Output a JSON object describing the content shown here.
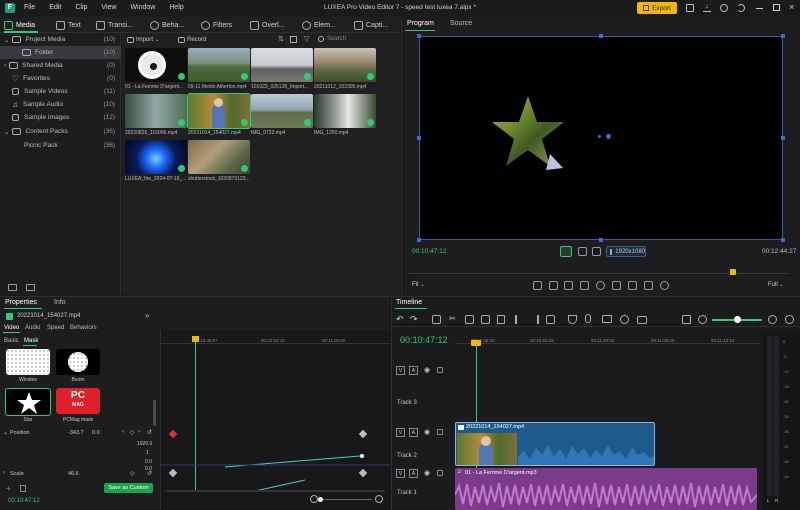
{
  "app": {
    "logo_glyph": "F",
    "menu": [
      "File",
      "Edit",
      "Clip",
      "View",
      "Window",
      "Help"
    ],
    "title": "LUXEA Pro Video Editor 7 - speed test luxea 7.alpx *",
    "export_label": "Export",
    "accent": "#f5b700"
  },
  "tabs": [
    {
      "label": "Media",
      "icon": "media-icon"
    },
    {
      "label": "Text",
      "icon": "text-icon"
    },
    {
      "label": "Transi...",
      "icon": "transition-icon"
    },
    {
      "label": "Beha...",
      "icon": "behavior-icon"
    },
    {
      "label": "Filters",
      "icon": "filters-icon"
    },
    {
      "label": "Overl...",
      "icon": "overlay-icon"
    },
    {
      "label": "Elem...",
      "icon": "elements-icon"
    },
    {
      "label": "Capti...",
      "icon": "captions-icon"
    }
  ],
  "library": {
    "tree": [
      {
        "label": "Project Media",
        "count": "(10)"
      },
      {
        "label": "Folder",
        "count": "(10)"
      },
      {
        "label": "Shared Media",
        "count": "(0)"
      },
      {
        "label": "Favorites",
        "count": "(0)"
      },
      {
        "label": "Sample Videos",
        "count": "(11)"
      },
      {
        "label": "Sample Audio",
        "count": "(10)"
      },
      {
        "label": "Sample Images",
        "count": "(12)"
      },
      {
        "label": "Content Packs",
        "count": "(36)"
      },
      {
        "label": "Picnic Pack",
        "count": "(36)"
      }
    ],
    "import_label": "Import",
    "record_label": "Record",
    "search_placeholder": "Search",
    "items": [
      "01 - La Femme D'argent...",
      "09-11 Menlo Atherton.mp4",
      "101023_025128_Import...",
      "20211012_152305.mp4",
      "20220826_115006.mp4",
      "20221014_154027.mp4",
      "IMG_0722.mp4",
      "IMG_1250.mp4",
      "LUXEA_fire_2024-07-16_...",
      "shutterstock_1020873123..."
    ]
  },
  "preview": {
    "tab_program": "Program",
    "tab_source": "Source",
    "timecode_start": "00:10:47:12",
    "timecode_end": "00:12:44:27",
    "resolution": "1920x1080",
    "fit_label": "Fit",
    "full_label": "Full"
  },
  "properties": {
    "tab_properties": "Properties",
    "tab_info": "Info",
    "clip_name": "20221014_154027.mp4",
    "sub_tabs": [
      "Video",
      "Audio",
      "Speed",
      "Behaviors"
    ],
    "mask_tabs": [
      "Basic",
      "Mask"
    ],
    "masks": [
      "Window",
      "Boom",
      "Star",
      "PCMag mask"
    ],
    "pcmag_text": [
      "PC",
      "MAG"
    ],
    "position_label": "Position",
    "position_x": "-343.7",
    "position_y": "0.0",
    "val_1920": "1920.0",
    "val_1": "1",
    "val_0a": "0.0",
    "val_0b": "0.0",
    "scale_label": "Scale",
    "scale_value": "46.6",
    "save_custom": "Save as Custom",
    "timecode": "00:10:47:12",
    "ruler": [
      "00:10:45:07",
      "00:10:53:15",
      "00:11:00:00"
    ]
  },
  "timeline": {
    "title": "Timeline",
    "timecode": "00:10:47:12",
    "ruler": [
      "00:10:45:00",
      "00:10:53:15",
      "00:11:00:00",
      "00:11:06:20",
      "00:11:13:10"
    ],
    "tracks": [
      "Track 3",
      "Track 2",
      "Track 1"
    ],
    "video_clip": "20221014_154027.mp4",
    "audio_clip": "01 - La Femme D'argent.mp3",
    "meter_labels": [
      "0",
      "-6",
      "-12",
      "-18",
      "-24",
      "-30",
      "-36",
      "-42",
      "-48",
      "-54"
    ],
    "meter_lr": [
      "L",
      "R"
    ],
    "video_color": "#1f5a8c",
    "audio_color": "#7a3b8a"
  }
}
